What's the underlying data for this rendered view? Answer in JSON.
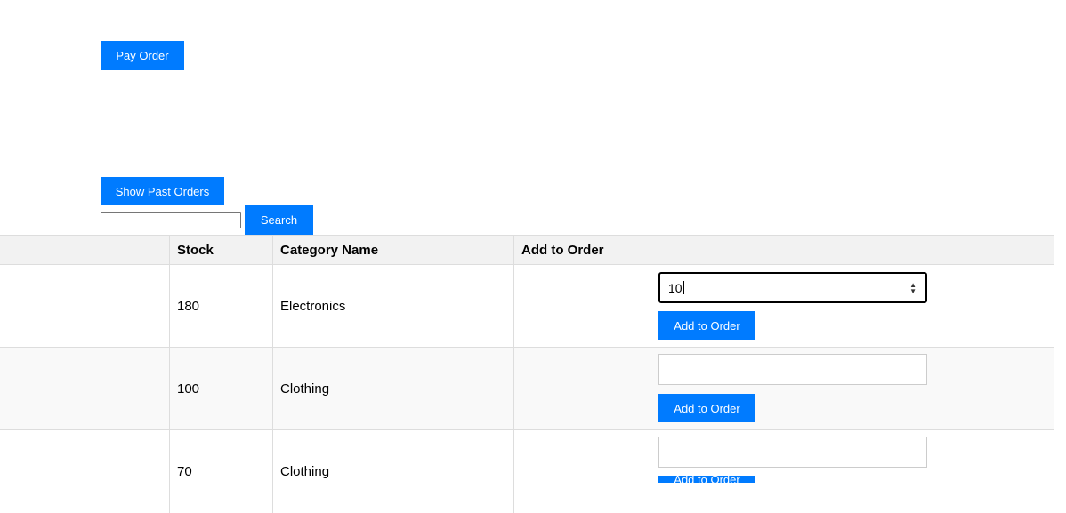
{
  "actions": {
    "pay_order_label": "Pay Order",
    "past_orders_label": "Show Past Orders",
    "search_label": "Search",
    "search_value": ""
  },
  "table": {
    "headers": [
      "",
      "Stock",
      "Category Name",
      "Add to Order"
    ],
    "rows": [
      {
        "stock": "180",
        "category": "Electronics",
        "quantity": "10",
        "button_label": "Add to Order"
      },
      {
        "stock": "100",
        "category": "Clothing",
        "quantity": "",
        "button_label": "Add to Order"
      },
      {
        "stock": "70",
        "category": "Clothing",
        "quantity": "",
        "button_label": "Add to Order"
      }
    ]
  },
  "icons": {
    "spinner": "number-spinner-icon"
  },
  "colors": {
    "primary": "#007bff",
    "header_bg": "#f2f2f2",
    "striped_row_bg": "#f9f9f9",
    "border": "#dddddd"
  }
}
